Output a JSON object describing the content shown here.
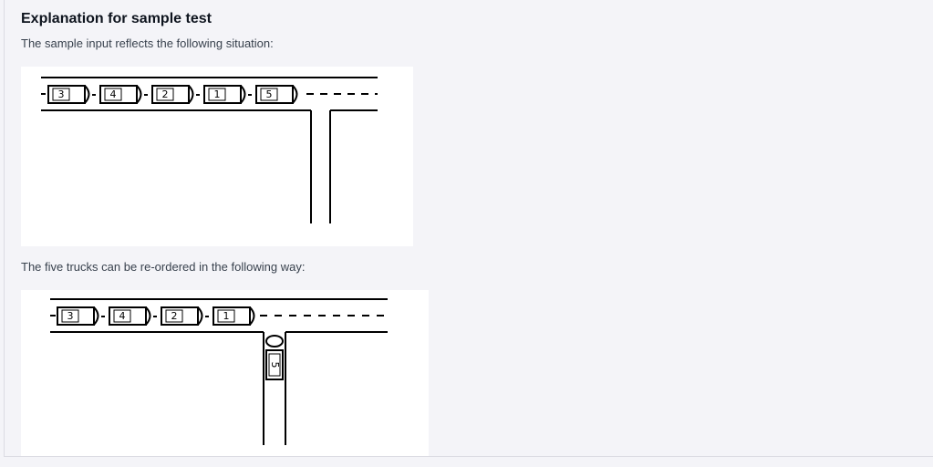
{
  "section": {
    "title": "Explanation for sample test",
    "intro": "The sample input reflects the following situation:",
    "middle": "The five trucks can be re-ordered in the following way:"
  },
  "figure1": {
    "trucks": [
      "3",
      "4",
      "2",
      "1",
      "5"
    ]
  },
  "figure2": {
    "road_trucks": [
      "3",
      "4",
      "2",
      "1"
    ],
    "branch_truck": "5"
  },
  "colors": {
    "background": "#f4f4f8",
    "figure_background": "#ffffff",
    "title": "#0e141e",
    "text": "#39424e",
    "ink": "#000000"
  }
}
